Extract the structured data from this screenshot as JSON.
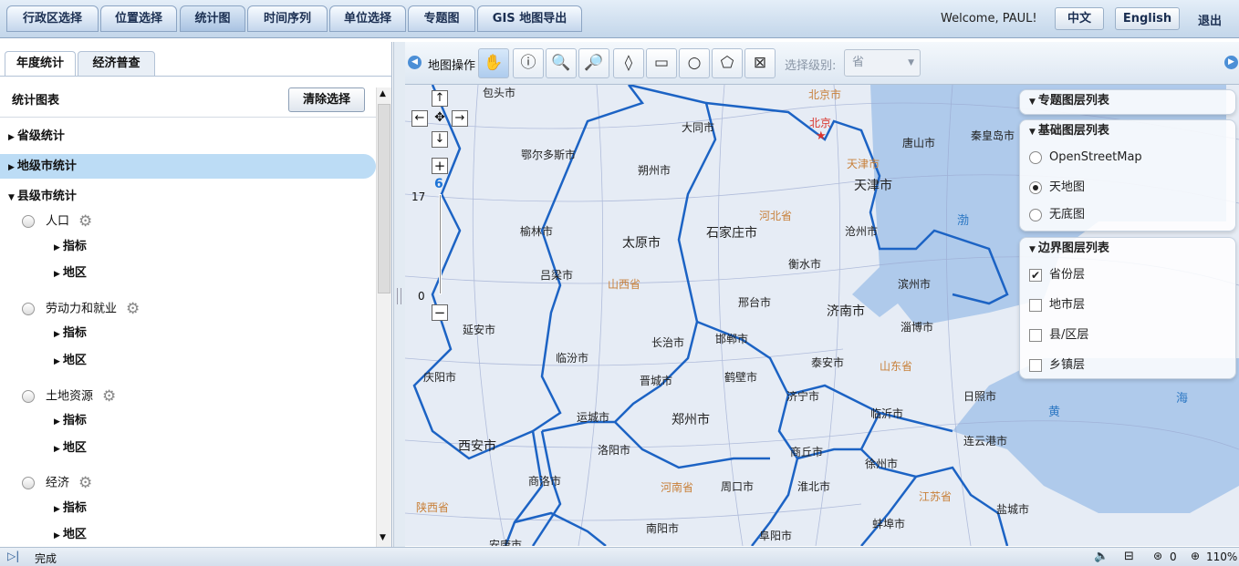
{
  "nav": {
    "tabs": [
      "行政区选择",
      "位置选择",
      "统计图",
      "时间序列",
      "单位选择",
      "专题图",
      "GIS 地图导出"
    ],
    "active": 2
  },
  "header": {
    "welcome": "Welcome, PAUL!",
    "lang_zh": "中文",
    "lang_en": "English",
    "logout": "退出"
  },
  "left": {
    "tabs": [
      "年度统计",
      "经济普查"
    ],
    "section_title": "统计图表",
    "clear_button": "清除选择",
    "categories": [
      "省级统计",
      "地级市统计",
      "县级市统计"
    ],
    "subcats": [
      "人口",
      "劳动力和就业",
      "土地资源",
      "经济"
    ],
    "leaf_indicator": "指标",
    "leaf_region": "地区"
  },
  "toolbar": {
    "map_ops_label": "地图操作",
    "level_label": "选择级别:",
    "level_value": "省"
  },
  "map": {
    "zoom_max": "17",
    "zoom_min": "0",
    "zoom_level": "6",
    "capital_label": "北京"
  },
  "layers": {
    "thematic_title": "专题图层列表",
    "base_title": "基础图层列表",
    "base_items": [
      "OpenStreetMap",
      "天地图",
      "无底图"
    ],
    "base_selected": 1,
    "boundary_title": "边界图层列表",
    "boundary_items": [
      "省份层",
      "地市层",
      "县/区层",
      "乡镇层"
    ],
    "boundary_checked": [
      true,
      false,
      false,
      false
    ]
  },
  "status": {
    "text": "完成",
    "zone": "0",
    "zoom": "110%"
  }
}
